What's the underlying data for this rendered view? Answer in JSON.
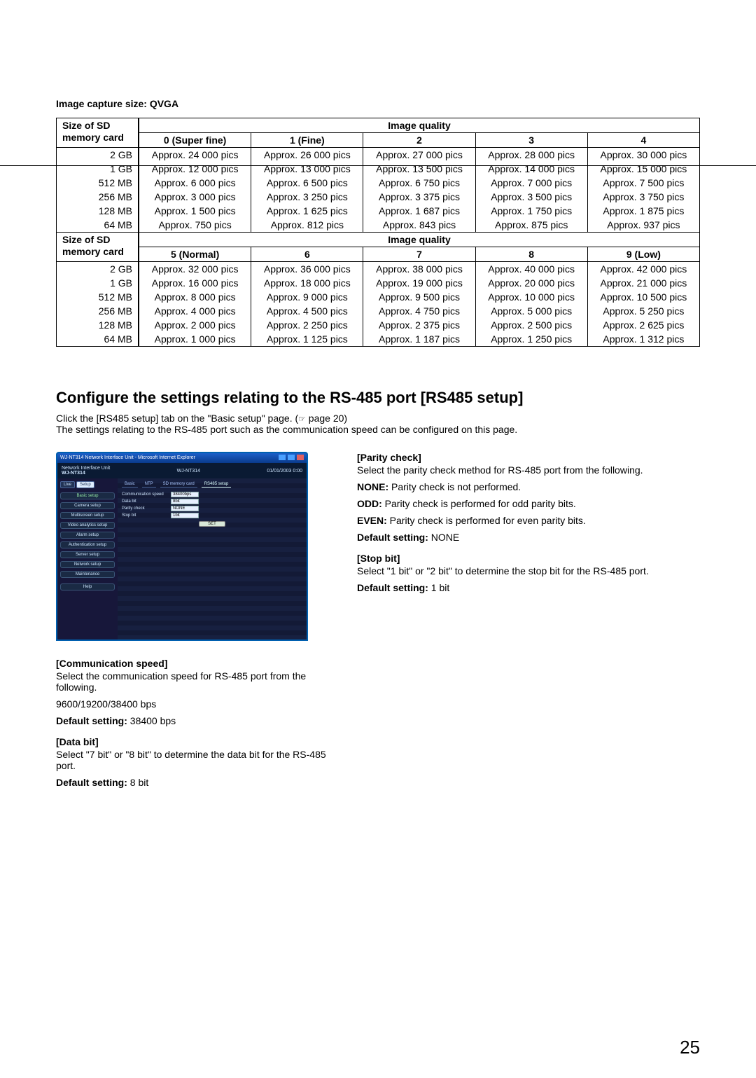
{
  "title1": "Image capture size: QVGA",
  "table1": {
    "hdr_size_l1": "Size of SD",
    "hdr_size_l2": "memory card",
    "hdr_iq": "Image quality",
    "qcols": [
      "0 (Super fine)",
      "1 (Fine)",
      "2",
      "3",
      "4"
    ],
    "sizes": [
      "2 GB",
      "1 GB",
      "512 MB",
      "256 MB",
      "128 MB",
      "64 MB"
    ],
    "data": [
      [
        "Approx. 24 000 pics",
        "Approx. 26 000 pics",
        "Approx. 27 000 pics",
        "Approx. 28 000 pics",
        "Approx. 30 000 pics"
      ],
      [
        "Approx. 12 000 pics",
        "Approx. 13 000 pics",
        "Approx. 13 500 pics",
        "Approx. 14 000 pics",
        "Approx. 15 000 pics"
      ],
      [
        "Approx. 6 000 pics",
        "Approx. 6 500 pics",
        "Approx. 6 750 pics",
        "Approx. 7 000 pics",
        "Approx. 7 500 pics"
      ],
      [
        "Approx. 3 000 pics",
        "Approx. 3 250 pics",
        "Approx. 3 375 pics",
        "Approx. 3 500 pics",
        "Approx. 3 750 pics"
      ],
      [
        "Approx. 1 500 pics",
        "Approx. 1 625 pics",
        "Approx. 1 687 pics",
        "Approx. 1 750 pics",
        "Approx. 1 875 pics"
      ],
      [
        "Approx. 750 pics",
        "Approx. 812 pics",
        "Approx. 843 pics",
        "Approx. 875 pics",
        "Approx. 937 pics"
      ]
    ]
  },
  "table2": {
    "hdr_size_l1": "Size of SD",
    "hdr_size_l2": "memory card",
    "hdr_iq": "Image quality",
    "qcols": [
      "5 (Normal)",
      "6",
      "7",
      "8",
      "9 (Low)"
    ],
    "sizes": [
      "2 GB",
      "1 GB",
      "512 MB",
      "256 MB",
      "128 MB",
      "64 MB"
    ],
    "data": [
      [
        "Approx. 32 000 pics",
        "Approx. 36 000 pics",
        "Approx. 38 000 pics",
        "Approx. 40 000 pics",
        "Approx. 42 000 pics"
      ],
      [
        "Approx. 16 000 pics",
        "Approx. 18 000 pics",
        "Approx. 19 000 pics",
        "Approx. 20 000 pics",
        "Approx. 21 000 pics"
      ],
      [
        "Approx. 8 000 pics",
        "Approx. 9 000 pics",
        "Approx. 9 500 pics",
        "Approx. 10 000 pics",
        "Approx. 10 500 pics"
      ],
      [
        "Approx. 4 000 pics",
        "Approx. 4 500 pics",
        "Approx. 4 750 pics",
        "Approx. 5 000 pics",
        "Approx. 5 250 pics"
      ],
      [
        "Approx. 2 000 pics",
        "Approx. 2 250 pics",
        "Approx. 2 375 pics",
        "Approx. 2 500 pics",
        "Approx. 2 625 pics"
      ],
      [
        "Approx. 1 000 pics",
        "Approx. 1 125 pics",
        "Approx. 1 187 pics",
        "Approx. 1 250 pics",
        "Approx. 1 312 pics"
      ]
    ]
  },
  "h2": "Configure the settings relating to the RS-485 port [RS485 setup]",
  "intro1": "Click the [RS485 setup] tab on the \"Basic setup\" page. (",
  "intro_ref": "☞",
  "intro_page": " page 20)",
  "intro2": "The settings relating to the RS-485 port such as the communication speed can be configured on this page.",
  "screenshot": {
    "window_title": "WJ-NT314 Network Interface Unit - Microsoft Internet Explorer",
    "h2_left1": "Network Interface Unit",
    "h2_left2": "WJ-NT314",
    "h2_center": "WJ-NT314",
    "h2_right": "01/01/2003  0:00",
    "tab_live": "Live",
    "tab_setup": "Setup",
    "side": [
      "Basic setup",
      "Camera setup",
      "Multiscreen setup",
      "Video analytics setup",
      "Alarm setup",
      "Authentication setup",
      "Server setup",
      "Network setup",
      "Maintenance",
      "Help"
    ],
    "main_tabs": [
      "Basic",
      "NTP",
      "SD memory card",
      "RS485 setup"
    ],
    "form": {
      "comm_label": "Communication speed",
      "comm_value": "38400bps",
      "databit_label": "Data bit",
      "databit_value": "8bit",
      "parity_label": "Parity check",
      "parity_value": "NONE",
      "stopbit_label": "Stop bit",
      "stopbit_value": "1bit",
      "set_btn": "SET"
    }
  },
  "left": {
    "h_comm": "[Communication speed]",
    "comm_p1": "Select the communication speed for RS-485 port from the following.",
    "comm_p2": "9600/19200/38400 bps",
    "comm_def_lbl": "Default setting:",
    "comm_def_val": " 38400 bps",
    "h_data": "[Data bit]",
    "data_p1": "Select \"7 bit\" or \"8 bit\" to determine the data bit for the RS-485 port.",
    "data_def_lbl": "Default setting:",
    "data_def_val": " 8 bit"
  },
  "right": {
    "h_parity": "[Parity check]",
    "par_p1": "Select the parity check method for RS-485 port from the following.",
    "par_none_lbl": "NONE:",
    "par_none_txt": " Parity check is not performed.",
    "par_odd_lbl": "ODD:",
    "par_odd_txt": " Parity check is performed for odd parity bits.",
    "par_even_lbl": "EVEN:",
    "par_even_txt": " Parity check is performed for even parity bits.",
    "par_def_lbl": "Default setting:",
    "par_def_val": " NONE",
    "h_stop": "[Stop bit]",
    "stop_p1": "Select \"1 bit\" or \"2 bit\" to determine the stop bit for the RS-485 port.",
    "stop_def_lbl": "Default setting:",
    "stop_def_val": " 1 bit"
  },
  "page_number": "25"
}
